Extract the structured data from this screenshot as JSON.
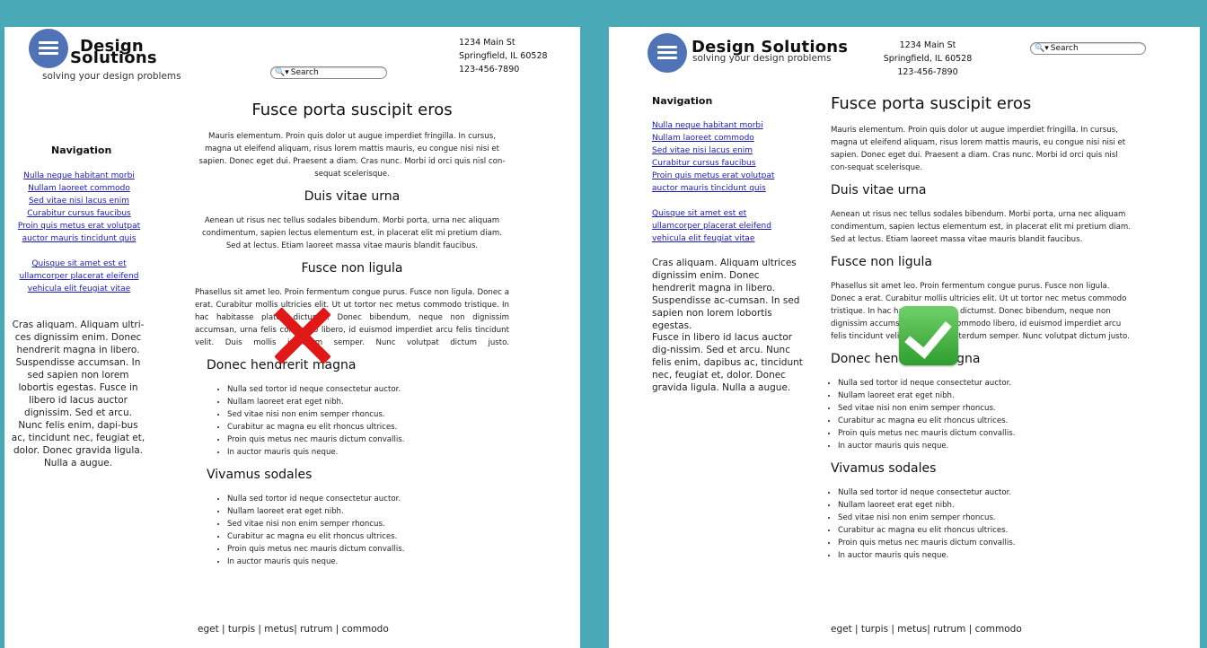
{
  "brand": {
    "title_line1": "Design",
    "title_line2": "Solutions",
    "title_full": "Design Solutions",
    "tagline": "solving your design problems"
  },
  "address": {
    "line1": "1234 Main St",
    "line2": "Springfield, IL 60528",
    "line3": "123-456-7890"
  },
  "search": {
    "icon": "search-icon",
    "label": "Search"
  },
  "navigation": {
    "title": "Navigation",
    "group1": [
      "Nulla neque habitant morbi",
      "Nullam laoreet commodo",
      "Sed vitae nisi lacus enim",
      "Curabitur cursus faucibus",
      "Proin quis metus erat volutpat",
      "auctor mauris tincidunt quis"
    ],
    "group2": [
      "Quisque sit amet est et",
      "ullamcorper placerat eleifend",
      "vehicula elit feugiat vitae"
    ]
  },
  "sidebar_left": {
    "text": "Cras aliquam. Aliquam ultri-ces dignissim enim. Donec hendrerit magna in libero. Suspendisse accumsan. In sed sapien non lorem lobortis egestas. Fusce in libero id lacus auctor dignissim. Sed et arcu. Nunc felis enim, dapi-bus ac, tincidunt nec, feugiat et, dolor. Donec gravida ligula. Nulla a augue."
  },
  "sidebar_right": {
    "text1": "Cras aliquam. Aliquam ultrices dignissim enim. Donec hendrerit magna in libero. Suspendisse ac-cumsan. In sed sapien non lorem lobortis egestas.",
    "text2": "Fusce in libero id lacus auctor dig-nissim. Sed et arcu. Nunc felis enim, dapibus ac, tincidunt nec, feugiat et, dolor. Donec gravida ligula. Nulla a augue."
  },
  "content": {
    "h1": "Fusce porta suscipit eros",
    "p1": "Mauris elementum. Proin quis dolor ut augue imperdiet fringilla. In cursus, magna ut eleifend aliquam, risus lorem mattis mauris, eu congue nisi nisi et sapien. Donec eget dui. Praesent a diam. Cras nunc. Morbi id orci quis nisl con-sequat scelerisque.",
    "h2a": "Duis vitae urna",
    "p2": "Aenean ut risus nec tellus sodales bibendum. Morbi porta, urna nec aliquam condimentum, sapien lectus elementum est, in placerat elit mi pretium diam. Sed at lectus. Etiam laoreet massa vitae mauris blandit faucibus.",
    "h2b": "Fusce non ligula",
    "p3": "Phasellus sit amet leo. Proin fermentum congue purus. Fusce non ligula. Donec a erat. Curabitur mollis ultricies elit. Ut ut tortor nec metus commodo tristique. In hac habitasse platea dictumst. Donec bibendum, neque non dignissim accumsan, urna felis commodo libero, id euismod imperdiet arcu felis tincidunt velit. Duis mollis interdum semper. Nunc volutpat dictum justo.",
    "h2c": "Donec hendrerit magna",
    "list1": [
      "Nulla sed tortor id neque consectetur auctor.",
      "Nullam laoreet erat eget nibh.",
      "Sed vitae nisi non enim semper rhoncus.",
      "Curabitur ac magna eu elit rhoncus ultrices.",
      "Proin quis metus nec mauris dictum convallis.",
      "In auctor mauris quis neque."
    ],
    "h2d": "Vivamus sodales",
    "list2": [
      "Nulla sed tortor id neque consectetur auctor.",
      "Nullam laoreet erat eget nibh.",
      "Sed vitae nisi non enim semper rhoncus.",
      "Curabitur ac magna eu elit rhoncus ultrices.",
      "Proin quis metus nec mauris dictum convallis.",
      "In auctor mauris quis neque."
    ]
  },
  "footer": "eget | turpis | metus| rutrum | commodo",
  "marks": {
    "left": "red-cross-icon",
    "right": "green-check-icon"
  },
  "colors": {
    "background": "#4aa9b6",
    "logo": "#4f73b5",
    "link": "#1a1ab8",
    "cross": "#e01818",
    "check": "#2f9e2f"
  }
}
